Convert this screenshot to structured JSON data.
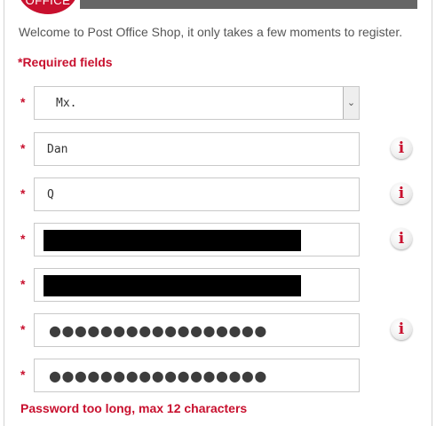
{
  "brand": {
    "logo_text": "OFFICE"
  },
  "intro": {
    "welcome": "Welcome to Post Office Shop, it only takes a few moments to register.",
    "required_note": "*Required fields"
  },
  "form": {
    "required_marker": "*",
    "title_select": {
      "value": "Mx.",
      "chevron": "⌄"
    },
    "first_name": {
      "value": "Dan"
    },
    "last_name": {
      "value": "Q"
    },
    "password": {
      "value": "●●●●●●●●●●●●●●●●●"
    },
    "confirm_password": {
      "value": "●●●●●●●●●●●●●●●●●"
    },
    "info_icon_glyph": "i",
    "error_message": "Password too long, max 12 characters"
  }
}
